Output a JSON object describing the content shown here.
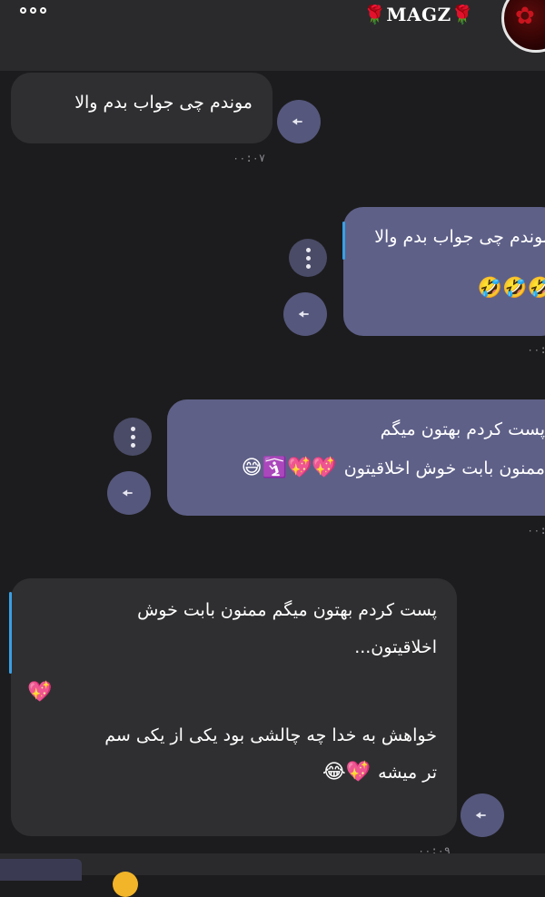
{
  "header": {
    "title": "🌹MAGZ🌹"
  },
  "messages": [
    {
      "text": "موندم چی جواب بدم والا",
      "time": "۰۰:۰۷"
    },
    {
      "text": "موندم چی جواب بدم والا",
      "emoji": "🤣🤣🤣",
      "time": "۰۰:"
    },
    {
      "line1": "پست کردم بهتون میگم",
      "line2": "ممنون بابت خوش اخلاقیتون",
      "emoji": "😅🛐💖💖",
      "time": "۰۰:"
    },
    {
      "line1": "پست کردم بهتون میگم ممنون بابت خوش",
      "line2": "اخلاقیتون...",
      "emoji": "💖",
      "line3": "خواهش به خدا چه چالشی بود یکی از یکی سم",
      "line4": "تر میشه",
      "emoji2": "😂💖",
      "time": "۰۰:۰۹"
    }
  ]
}
